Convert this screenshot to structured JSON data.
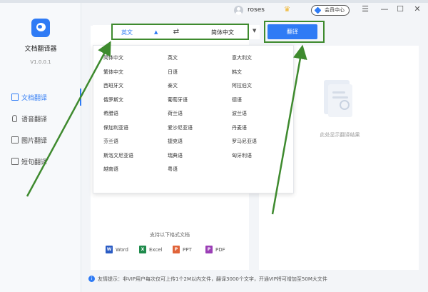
{
  "app": {
    "name": "文档翻译器",
    "version": "V1.0.0.1"
  },
  "sidebar": {
    "items": [
      {
        "label": "文档翻译",
        "icon": "document-icon",
        "active": true
      },
      {
        "label": "语音翻译",
        "icon": "microphone-icon",
        "active": false
      },
      {
        "label": "图片翻译",
        "icon": "image-icon",
        "active": false
      },
      {
        "label": "短句翻译",
        "icon": "text-icon",
        "active": false
      }
    ]
  },
  "header": {
    "username": "roses",
    "member_label": "会员中心",
    "menu_glyph": "☰",
    "minimize_glyph": "—",
    "maximize_glyph": "☐",
    "close_glyph": "✕"
  },
  "toolbar": {
    "source_lang": "英文",
    "source_caret": "▲",
    "swap_glyph": "⇄",
    "target_lang": "简体中文",
    "target_caret": "▼",
    "translate_label": "翻译"
  },
  "dropdown": {
    "languages": [
      [
        "简体中文",
        "英文",
        "意大利文"
      ],
      [
        "繁体中文",
        "日语",
        "韩文"
      ],
      [
        "西班牙文",
        "泰文",
        "阿拉伯文"
      ],
      [
        "俄罗斯文",
        "葡萄牙语",
        "德语"
      ],
      [
        "希腊语",
        "荷兰语",
        "波兰语"
      ],
      [
        "保加利亚语",
        "爱沙尼亚语",
        "丹麦语"
      ],
      [
        "芬兰语",
        "捷克语",
        "罗马尼亚语"
      ],
      [
        "斯洛文尼亚语",
        "瑞典语",
        "匈牙利语"
      ],
      [
        "越南语",
        "粤语",
        ""
      ]
    ]
  },
  "result": {
    "placeholder": "此处显示翻译结果"
  },
  "formats": {
    "title": "支持以下格式文档",
    "items": [
      {
        "label": "Word",
        "icon": "word-icon",
        "color": "#2b5cc4",
        "glyph": "W"
      },
      {
        "label": "Excel",
        "icon": "excel-icon",
        "color": "#1f8b4c",
        "glyph": "X"
      },
      {
        "label": "PPT",
        "icon": "ppt-icon",
        "color": "#e0643a",
        "glyph": "P"
      },
      {
        "label": "PDF",
        "icon": "pdf-icon",
        "color": "#9b3fb6",
        "glyph": "P"
      }
    ]
  },
  "footer": {
    "tip": "友情提示：非VIP用户每次仅可上传1个2M以内文件，翻译3000个文字，开通VIP将可增加至50M大文件"
  },
  "colors": {
    "accent": "#2f7bf5",
    "annotation_green": "#3e8a2e",
    "vip_gold": "#f0b429"
  }
}
